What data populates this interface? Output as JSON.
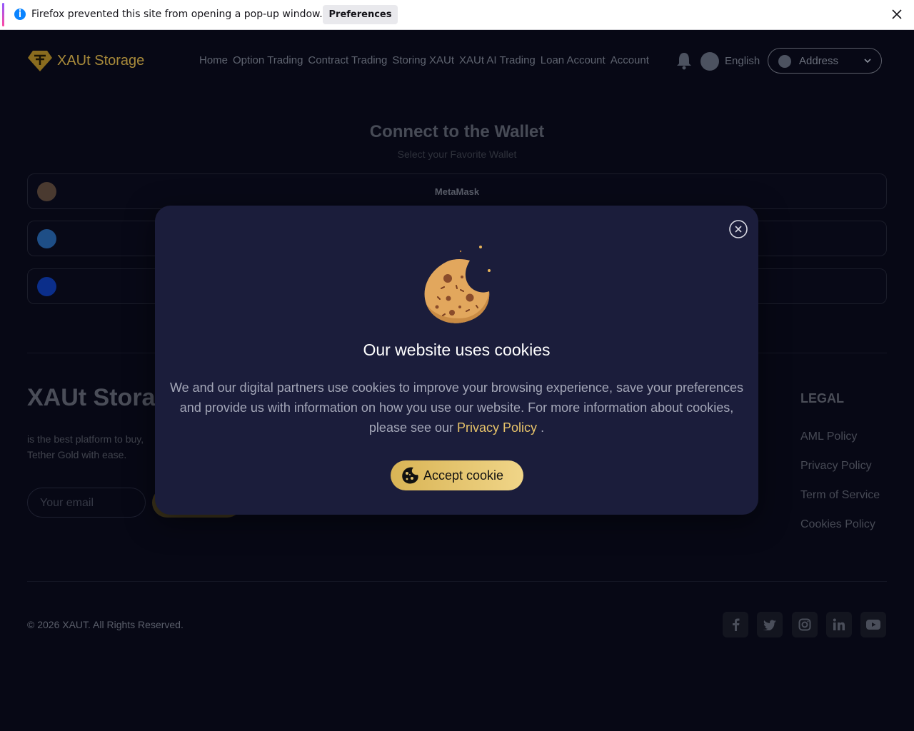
{
  "notification": {
    "message": "Firefox prevented this site from opening a pop-up window.",
    "preferences_label": "Preferences"
  },
  "header": {
    "brand": "XAUt Storage",
    "nav": [
      "Home",
      "Option Trading",
      "Contract Trading",
      "Storing XAUt",
      "XAUt AI Trading",
      "Loan Account",
      "Account"
    ],
    "language": "English",
    "address_label": "Address"
  },
  "connect": {
    "title": "Connect to the Wallet",
    "subtitle": "Select your Favorite Wallet",
    "wallets": [
      {
        "name": "MetaMask",
        "icon": "metamask-icon",
        "color": "#e2761b"
      },
      {
        "name": "",
        "icon": "walletconnect-icon",
        "color": "#3b99fc"
      },
      {
        "name": "",
        "icon": "coinbase-icon",
        "color": "#0052ff"
      }
    ]
  },
  "footer": {
    "brand": "XAUt Storag",
    "description": "is the best platform to buy, Tether Gold with ease.",
    "email_placeholder": "Your email",
    "legal_heading": "LEGAL",
    "legal_links": [
      "AML Policy",
      "Privacy Policy",
      "Term of Service",
      "Cookies Policy"
    ],
    "copyright": "© 2026 XAUT. All Rights Reserved.",
    "social": [
      "facebook-icon",
      "twitter-icon",
      "instagram-icon",
      "linkedin-icon",
      "youtube-icon"
    ]
  },
  "cookie_modal": {
    "title": "Our website uses cookies",
    "text": "We and our digital partners use cookies to improve your browsing experience, save your preferences and provide us with information on how you use our website. For more information about cookies, please see our",
    "privacy_link": "Privacy Policy",
    "text_end": " .",
    "accept_label": "Accept cookie"
  },
  "colors": {
    "accent": "#e7c36a",
    "modal_bg": "#1b1d3b",
    "page_bg": "#070815"
  }
}
